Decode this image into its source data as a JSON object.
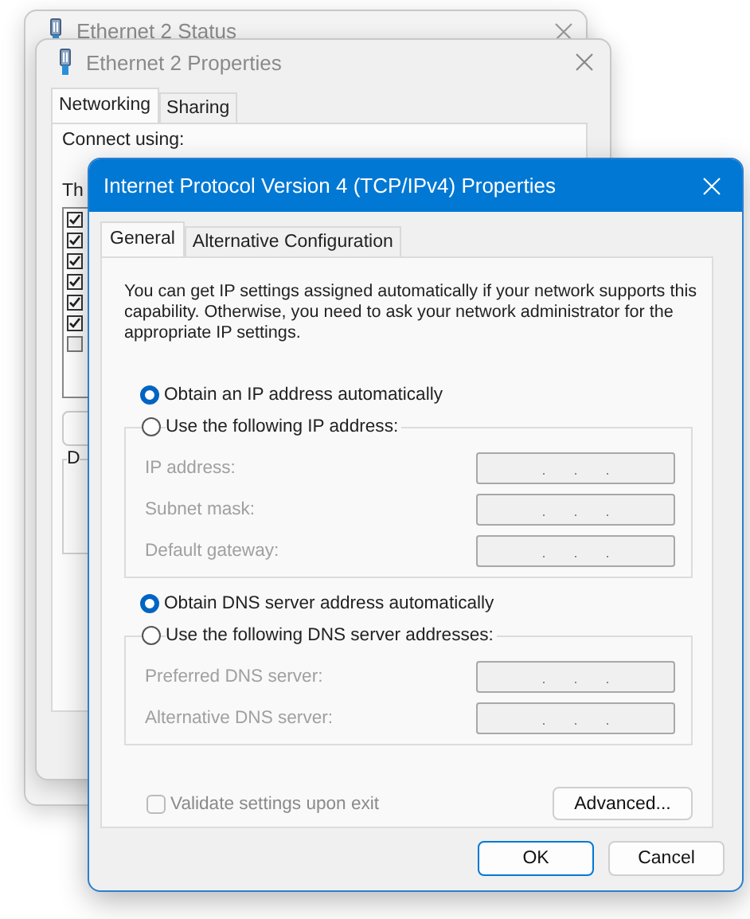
{
  "status_window": {
    "title": "Ethernet 2 Status"
  },
  "properties_window": {
    "title": "Ethernet 2 Properties",
    "tabs": [
      {
        "label": "Networking",
        "selected": true
      },
      {
        "label": "Sharing",
        "selected": false
      }
    ],
    "connect_label": "Connect using:",
    "items_label": "Th",
    "items": [
      {
        "checked": true
      },
      {
        "checked": true
      },
      {
        "checked": true
      },
      {
        "checked": true
      },
      {
        "checked": true
      },
      {
        "checked": true
      },
      {
        "checked": false
      }
    ],
    "group_label": "D"
  },
  "dialog": {
    "title": "Internet Protocol Version 4 (TCP/IPv4) Properties",
    "tabs": [
      {
        "label": "General",
        "selected": true
      },
      {
        "label": "Alternative Configuration",
        "selected": false
      }
    ],
    "description": "You can get IP settings assigned automatically if your network supports this capability. Otherwise, you need to ask your network administrator for the appropriate IP settings.",
    "sections": [
      {
        "options": [
          {
            "label": "Obtain an IP address automatically",
            "selected": true
          },
          {
            "label": "Use the following IP address:",
            "selected": false
          }
        ],
        "disabled": true,
        "fields": [
          {
            "label": "IP address:"
          },
          {
            "label": "Subnet mask:"
          },
          {
            "label": "Default gateway:"
          }
        ]
      },
      {
        "options": [
          {
            "label": "Obtain DNS server address automatically",
            "selected": true
          },
          {
            "label": "Use the following DNS server addresses:",
            "selected": false
          }
        ],
        "disabled": true,
        "fields": [
          {
            "label": "Preferred DNS server:"
          },
          {
            "label": "Alternative DNS server:"
          }
        ]
      }
    ],
    "validate": {
      "label": "Validate settings upon exit",
      "checked": false,
      "disabled": true
    },
    "advanced_button": "Advanced...",
    "buttons": [
      {
        "label": "OK",
        "default": true
      },
      {
        "label": "Cancel",
        "default": false
      }
    ]
  }
}
